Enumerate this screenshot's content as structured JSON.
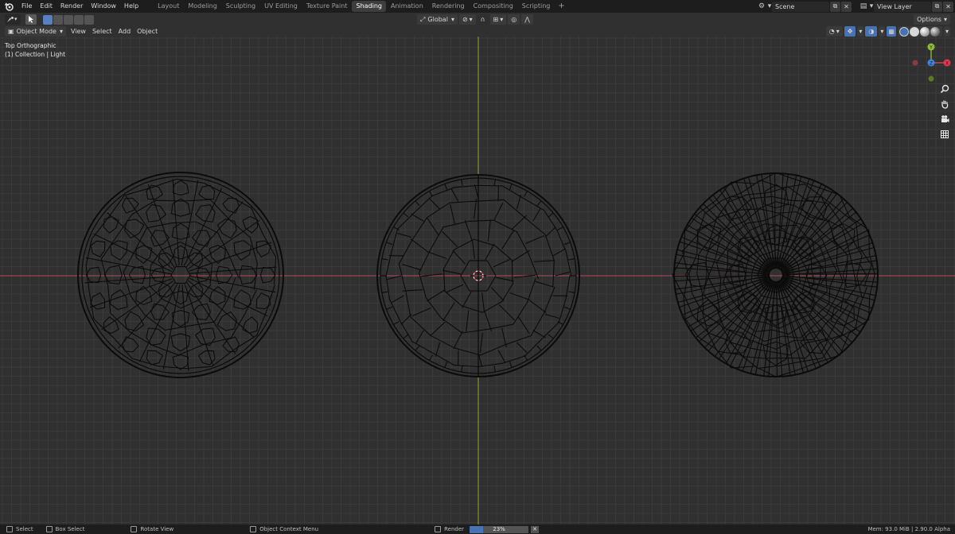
{
  "topbar": {
    "menus": [
      "File",
      "Edit",
      "Render",
      "Window",
      "Help"
    ],
    "workspace_tabs": [
      "Layout",
      "Modeling",
      "Sculpting",
      "UV Editing",
      "Texture Paint",
      "Shading",
      "Animation",
      "Rendering",
      "Compositing",
      "Scripting"
    ],
    "active_tab": "Shading",
    "add_tab": "+",
    "scene": "Scene",
    "view_layer": "View Layer"
  },
  "viewheader": {
    "mode": "Object Mode",
    "menus": [
      "View",
      "Select",
      "Add",
      "Object"
    ],
    "orientation": "Global",
    "options": "Options"
  },
  "viewport": {
    "view_name": "Top Orthographic",
    "collection": "(1) Collection | Light",
    "axis_labels": {
      "y": "Y",
      "z": "Z",
      "x": "X"
    },
    "colors": {
      "x_axis": "#ba4a53",
      "y_axis": "#8aa832",
      "grid": "#3a3a3a",
      "background": "#303030",
      "wire": "#0b0b0b"
    },
    "objects": [
      "voronoi-sphere-left",
      "voronoi-sphere-center",
      "voronoi-sphere-right"
    ]
  },
  "statusbar": {
    "select": "Select",
    "box_select": "Box Select",
    "rotate_view": "Rotate View",
    "context_menu": "Object Context Menu",
    "render_label": "Render",
    "render_progress_text": "23%",
    "render_progress": 0.23,
    "memory": "Mem: 93.0 MiB | 2.90.0 Alpha"
  }
}
